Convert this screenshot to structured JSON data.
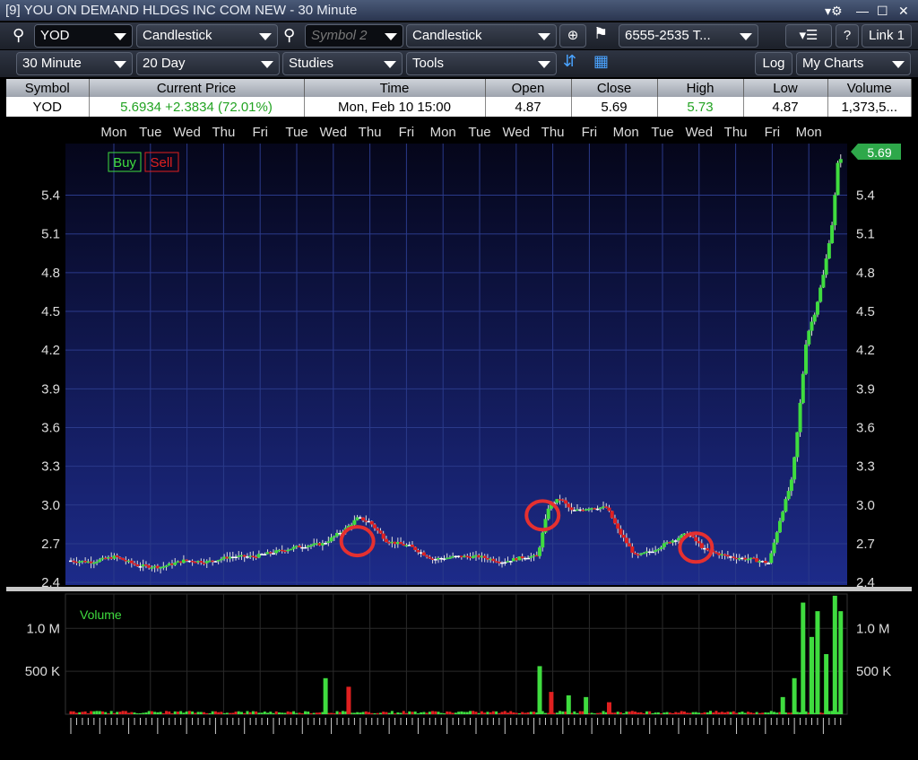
{
  "window": {
    "title": "[9] YOU ON DEMAND HLDGS INC COM NEW - 30 Minute",
    "controls": [
      "▾⚙",
      "—",
      "☐",
      "✕"
    ]
  },
  "toolbar": {
    "symbol": "YOD",
    "chart_type": "Candlestick",
    "symbol2_placeholder": "Symbol 2",
    "chart_type2": "Candlestick",
    "account": "6555-2535 T...",
    "help_label": "?",
    "link_label": "Link 1",
    "interval": "30 Minute",
    "range": "20 Day",
    "studies": "Studies",
    "tools": "Tools",
    "log_label": "Log",
    "my_charts": "My Charts"
  },
  "quote": {
    "headers": [
      "Symbol",
      "Current Price",
      "Time",
      "Open",
      "Close",
      "High",
      "Low",
      "Volume"
    ],
    "symbol": "YOD",
    "current_price": "5.6934  +2.3834  (72.01%)",
    "time": "Mon, Feb 10  15:00",
    "open": "4.87",
    "close": "5.69",
    "high": "5.73",
    "low": "4.87",
    "volume": "1,373,5..."
  },
  "chart_data": {
    "type": "candlestick",
    "day_labels": [
      "Mon",
      "Tue",
      "Wed",
      "Thu",
      "Fri",
      "Tue",
      "Wed",
      "Thu",
      "Fri",
      "Mon",
      "Tue",
      "Wed",
      "Thu",
      "Fri",
      "Mon",
      "Tue",
      "Wed",
      "Thu",
      "Fri",
      "Mon"
    ],
    "price_axis": {
      "ticks": [
        "5.4",
        "5.1",
        "4.8",
        "4.5",
        "4.2",
        "3.9",
        "3.6",
        "3.3",
        "3.0",
        "2.7",
        "2.4"
      ],
      "ylim": [
        2.38,
        5.8
      ]
    },
    "last_price_label": "5.69",
    "buy_label": "Buy",
    "sell_label": "Sell",
    "volume_label": "Volume",
    "volume_axis": {
      "ticks": [
        "1.0 M",
        "500 K"
      ],
      "ylim": [
        0,
        1400000
      ]
    },
    "colors": {
      "up": "#3fdc3f",
      "down": "#e02020",
      "neutral": "#ffffff",
      "annotation": "#e53030"
    },
    "annotation_circles": 3,
    "price_anchor_points": [
      [
        0,
        2.57
      ],
      [
        8,
        2.56
      ],
      [
        16,
        2.6
      ],
      [
        24,
        2.53
      ],
      [
        32,
        2.52
      ],
      [
        40,
        2.57
      ],
      [
        48,
        2.56
      ],
      [
        56,
        2.6
      ],
      [
        64,
        2.6
      ],
      [
        72,
        2.64
      ],
      [
        80,
        2.68
      ],
      [
        88,
        2.7
      ],
      [
        96,
        2.82
      ],
      [
        100,
        2.9
      ],
      [
        104,
        2.87
      ],
      [
        110,
        2.72
      ],
      [
        118,
        2.68
      ],
      [
        126,
        2.58
      ],
      [
        134,
        2.6
      ],
      [
        142,
        2.6
      ],
      [
        150,
        2.56
      ],
      [
        158,
        2.6
      ],
      [
        162,
        2.6
      ],
      [
        166,
        3.0
      ],
      [
        170,
        3.05
      ],
      [
        174,
        2.95
      ],
      [
        180,
        2.98
      ],
      [
        186,
        2.98
      ],
      [
        190,
        2.8
      ],
      [
        196,
        2.6
      ],
      [
        202,
        2.65
      ],
      [
        208,
        2.72
      ],
      [
        214,
        2.78
      ],
      [
        220,
        2.65
      ],
      [
        228,
        2.6
      ],
      [
        236,
        2.58
      ],
      [
        242,
        2.55
      ],
      [
        246,
        2.9
      ],
      [
        250,
        3.2
      ],
      [
        252,
        3.6
      ],
      [
        255,
        4.3
      ],
      [
        258,
        4.5
      ],
      [
        261,
        4.8
      ],
      [
        264,
        5.2
      ],
      [
        266,
        5.69
      ]
    ],
    "volume_spikes": [
      [
        88,
        420000,
        "up"
      ],
      [
        96,
        320000,
        "down"
      ],
      [
        162,
        560000,
        "up"
      ],
      [
        166,
        260000,
        "down"
      ],
      [
        172,
        220000,
        "up"
      ],
      [
        178,
        200000,
        "up"
      ],
      [
        186,
        140000,
        "down"
      ],
      [
        246,
        200000,
        "up"
      ],
      [
        250,
        420000,
        "up"
      ],
      [
        253,
        1300000,
        "up"
      ],
      [
        256,
        900000,
        "up"
      ],
      [
        258,
        1200000,
        "up"
      ],
      [
        261,
        700000,
        "up"
      ],
      [
        264,
        1380000,
        "up"
      ],
      [
        266,
        1200000,
        "up"
      ]
    ]
  }
}
